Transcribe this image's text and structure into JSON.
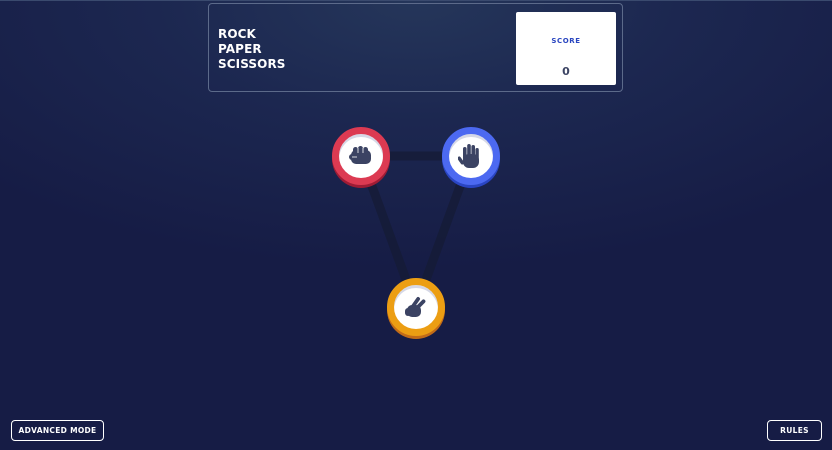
{
  "header": {
    "title_lines": [
      "ROCK",
      "PAPER",
      "SCISSORS"
    ],
    "score_label": "SCORE",
    "score_value": "0"
  },
  "choices": [
    {
      "name": "rock",
      "icon": "fist-icon",
      "color": "#dc3a52"
    },
    {
      "name": "paper",
      "icon": "open-hand-icon",
      "color": "#4c69f1"
    },
    {
      "name": "scissors",
      "icon": "peace-hand-icon",
      "color": "#ec9e13"
    }
  ],
  "footer": {
    "advanced_mode_label": "ADVANCED MODE",
    "rules_label": "RULES"
  },
  "colors": {
    "background": "#1c2750",
    "triangle": "#151b35",
    "icon": "#3b4363"
  }
}
